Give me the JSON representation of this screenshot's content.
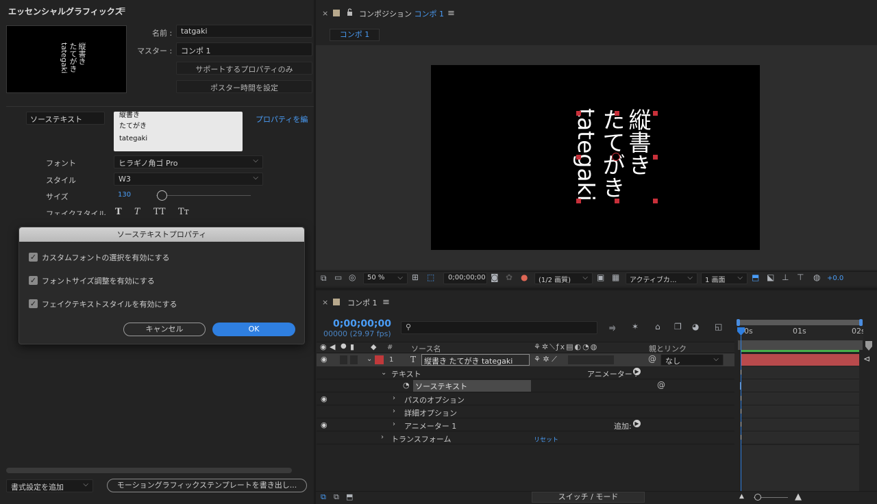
{
  "left_panel": {
    "title": "エッセンシャルグラフィックス",
    "menu_glyph": "≡",
    "preview_lines": [
      "縦書き",
      "たてがき",
      "tategaki"
    ],
    "name_label": "名前 :",
    "name_value": "tatgaki",
    "master_label": "マスター :",
    "master_value": "コンポ 1",
    "supported_props_button": "サポートするプロパティのみ",
    "set_poster_time_button": "ポスター時間を設定",
    "source_text_label": "ソーステキスト",
    "source_text_lines": [
      "縦書き",
      "たてがき",
      "tategaki"
    ],
    "edit_properties_link": "プロパティを編",
    "font_label": "フォント",
    "font_value": "ヒラギノ角ゴ Pro",
    "style_label": "スタイル",
    "style_value": "W3",
    "size_label": "サイズ",
    "size_value": "130",
    "faux_styles_label": "フェイクスタイル",
    "faux_style_glyphs": [
      "T",
      "T",
      "TT",
      "Tт"
    ],
    "add_formatting_select": "書式設定を追加",
    "export_mogrt_button": "モーショングラフィックステンプレートを書き出し..."
  },
  "dialog": {
    "title": "ソーステキストプロパティ",
    "options": [
      {
        "label": "カスタムフォントの選択を有効にする",
        "checked": true
      },
      {
        "label": "フォントサイズ調整を有効にする",
        "checked": true
      },
      {
        "label": "フェイクテキストスタイルを有効にする",
        "checked": true
      }
    ],
    "cancel_label": "キャンセル",
    "ok_label": "OK"
  },
  "comp_viewer": {
    "close_glyph": "×",
    "title_prefix": "コンポジション",
    "title_comp": "コンポ 1",
    "menu_glyph": "≡",
    "tab_label": "コンポ 1",
    "canvas_lines": [
      "縦書き",
      "たてがき",
      "tategaki"
    ],
    "zoom": "50 %",
    "timecode": "0;00;00;00",
    "resolution": "(1/2 画質)",
    "camera": "アクティブカ...",
    "view_layout": "1 画面",
    "exposure": "+0.0"
  },
  "timeline": {
    "close_glyph": "×",
    "comp_name": "コンポ 1",
    "menu_glyph": "≡",
    "timecode": "0;00;00;00",
    "frames_fps": "00000 (29.97 fps)",
    "search_placeholder": "",
    "col_num": "#",
    "col_source": "ソース名",
    "col_parent": "親とリンク",
    "ruler": [
      "0s",
      "01s",
      "02s"
    ],
    "layer": {
      "num": "1",
      "type_glyph": "T",
      "name": "縦書き たてがき tategaki",
      "parent": "なし",
      "label_color": "#c0393b"
    },
    "text_group": "テキスト",
    "animator_label": "アニメーター :",
    "source_text_prop": "ソーステキスト",
    "path_options": "パスのオプション",
    "more_options": "詳細オプション",
    "animator1": "アニメーター 1",
    "add_label": "追加:",
    "transform": "トランスフォーム",
    "reset": "リセット",
    "switch_mode": "スイッチ / モード"
  },
  "colors": {
    "accent_blue": "#4a9df7",
    "ok_button": "#2f7fe0",
    "layer_bar": "#b84a4c",
    "work_area_green": "#46b04a"
  }
}
